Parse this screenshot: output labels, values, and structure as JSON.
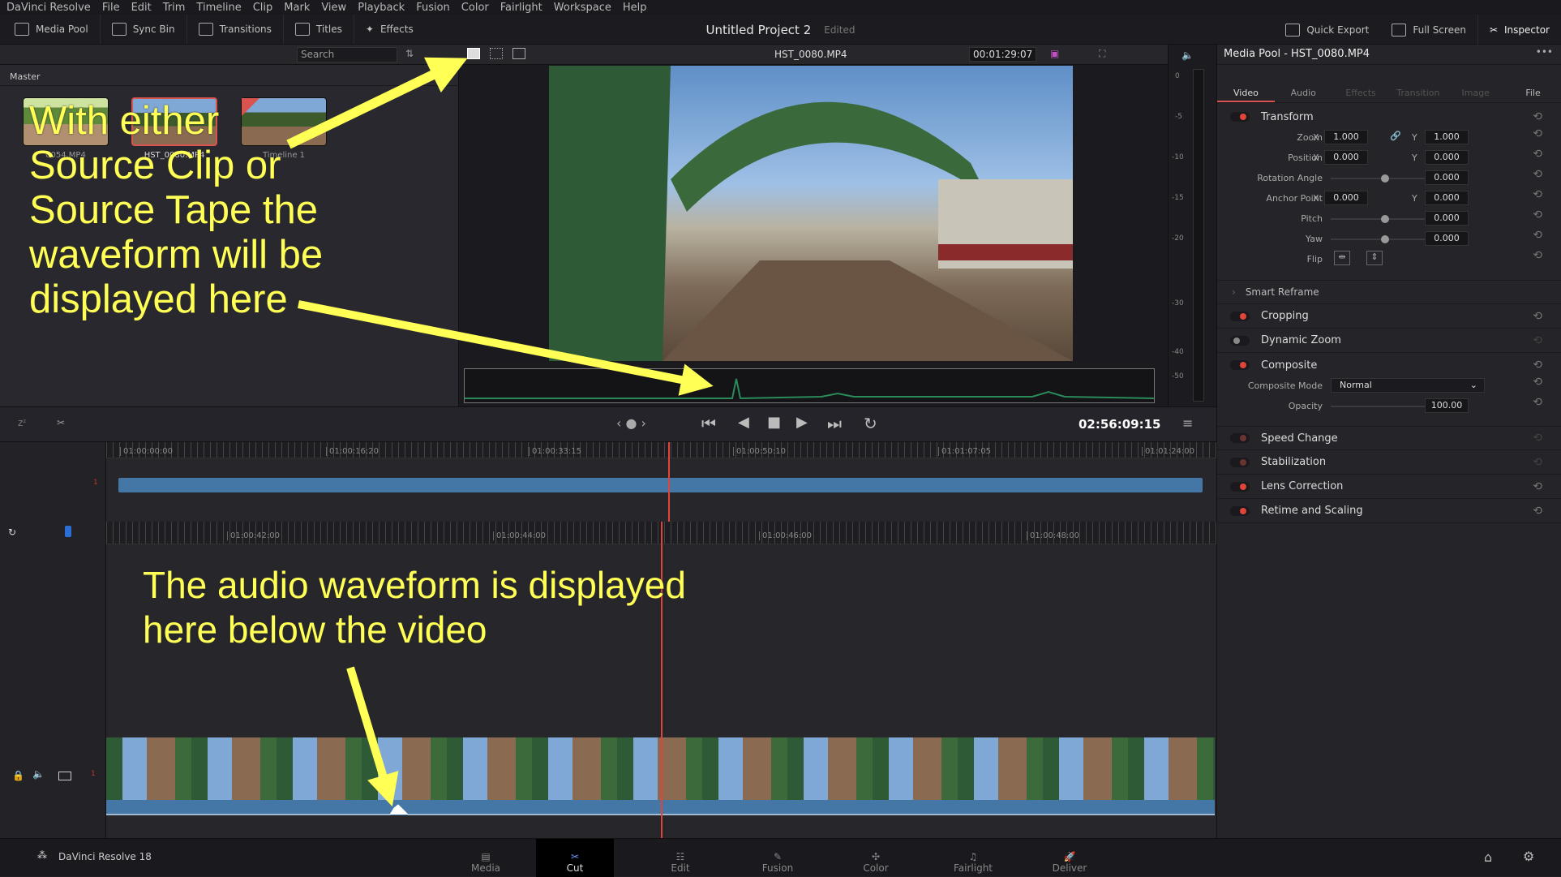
{
  "menu": [
    "DaVinci Resolve",
    "File",
    "Edit",
    "Trim",
    "Timeline",
    "Clip",
    "Mark",
    "View",
    "Playback",
    "Fusion",
    "Color",
    "Fairlight",
    "Workspace",
    "Help"
  ],
  "toolbar": {
    "media_pool": "Media Pool",
    "sync_bin": "Sync Bin",
    "transitions": "Transitions",
    "titles": "Titles",
    "effects": "Effects",
    "project_title": "Untitled Project 2",
    "project_status": "Edited",
    "quick_export": "Quick Export",
    "full_screen": "Full Screen",
    "inspector": "Inspector"
  },
  "pool": {
    "search_placeholder": "Search",
    "bin": "Master",
    "clips": [
      {
        "name": "0054.MP4"
      },
      {
        "name": "HST_0080.MP4"
      },
      {
        "name": "Timeline 1"
      }
    ]
  },
  "viewer": {
    "clip_name": "HST_0080.MP4",
    "duration": "00:01:29:07",
    "timecode": "02:56:09:15"
  },
  "meter": {
    "labels": [
      "0",
      "-5",
      "-10",
      "-15",
      "-20",
      "-30",
      "-40",
      "-50"
    ]
  },
  "inspector": {
    "title": "Media Pool - HST_0080.MP4",
    "tabs": [
      "Video",
      "Audio",
      "Effects",
      "Transition",
      "Image",
      "File"
    ],
    "active_tab": "Video",
    "transform": {
      "label": "Transform",
      "zoom_label": "Zoom",
      "zoom_x": "1.000",
      "zoom_y": "1.000",
      "position_label": "Position",
      "position_x": "0.000",
      "position_y": "0.000",
      "rotation_label": "Rotation Angle",
      "rotation": "0.000",
      "anchor_label": "Anchor Point",
      "anchor_x": "0.000",
      "anchor_y": "0.000",
      "pitch_label": "Pitch",
      "pitch": "0.000",
      "yaw_label": "Yaw",
      "yaw": "0.000",
      "flip_label": "Flip",
      "x": "X",
      "y": "Y"
    },
    "smart_reframe": "Smart Reframe",
    "cropping": "Cropping",
    "dynamic_zoom": "Dynamic Zoom",
    "composite": {
      "label": "Composite",
      "mode_label": "Composite Mode",
      "mode": "Normal",
      "opacity_label": "Opacity",
      "opacity": "100.00"
    },
    "speed_change": "Speed Change",
    "stabilization": "Stabilization",
    "lens_correction": "Lens Correction",
    "retime": "Retime and Scaling"
  },
  "timeline": {
    "upper_ticks": [
      "01:00:00:00",
      "01:00:16:20",
      "01:00:33:15",
      "01:00:50:10",
      "01:01:07:05",
      "01:01:24:00"
    ],
    "lower_ticks": [
      "01:00:42:00",
      "01:00:44:00",
      "01:00:46:00",
      "01:00:48:00"
    ],
    "track_num": "1"
  },
  "pages": {
    "app": "DaVinci Resolve 18",
    "items": [
      "Media",
      "Cut",
      "Edit",
      "Fusion",
      "Color",
      "Fairlight",
      "Deliver"
    ],
    "active": "Cut"
  },
  "annotations": {
    "top": "With either\nSource Clip or\nSource Tape the\nwaveform will be\ndisplayed here",
    "bottom": "The audio waveform is displayed\nhere below the video",
    "color": "#ffff55"
  },
  "colors": {
    "accent": "#e0443a",
    "clip_blue": "#4577a6",
    "playhead": "#e0443a"
  }
}
